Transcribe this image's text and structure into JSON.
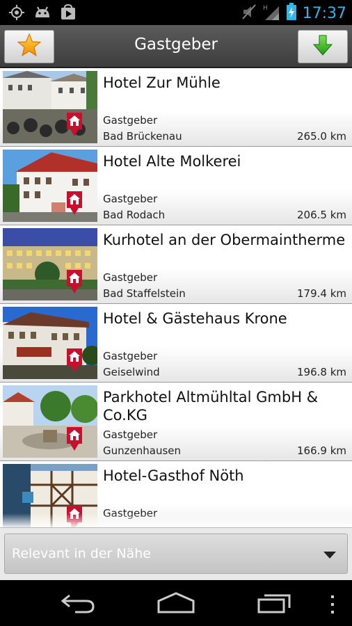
{
  "status_bar": {
    "time": "17:37",
    "icons": [
      "gps-icon",
      "android-icon",
      "play-store-icon",
      "mute-icon",
      "signal-h-icon",
      "battery-charging-icon"
    ]
  },
  "action_bar": {
    "title": "Gastgeber",
    "left_icon": "star-icon",
    "right_icon": "download-arrow-icon"
  },
  "list": {
    "items": [
      {
        "title": "Hotel Zur Mühle",
        "category": "Gastgeber",
        "city": "Bad Brückenau",
        "distance": "265.0 km"
      },
      {
        "title": "Hotel Alte Molkerei",
        "category": "Gastgeber",
        "city": "Bad Rodach",
        "distance": "206.5 km"
      },
      {
        "title": "Kurhotel an der Obermaintherme",
        "category": "Gastgeber",
        "city": "Bad Staffelstein",
        "distance": "179.4 km"
      },
      {
        "title": "Hotel & Gästehaus Krone",
        "category": "Gastgeber",
        "city": "Geiselwind",
        "distance": "196.8 km"
      },
      {
        "title": "Parkhotel Altmühltal GmbH & Co.KG",
        "category": "Gastgeber",
        "city": "Gunzenhausen",
        "distance": "166.9 km"
      },
      {
        "title": "Hotel-Gasthof Nöth",
        "category": "Gastgeber",
        "city": "",
        "distance": ""
      }
    ]
  },
  "filter": {
    "selected": "Relevant in der Nähe"
  },
  "nav_bar": {
    "icons": [
      "back-icon",
      "home-icon",
      "recent-apps-icon",
      "menu-dots-icon"
    ]
  },
  "colors": {
    "clock": "#33b5e5",
    "pin": "#c8102e"
  }
}
